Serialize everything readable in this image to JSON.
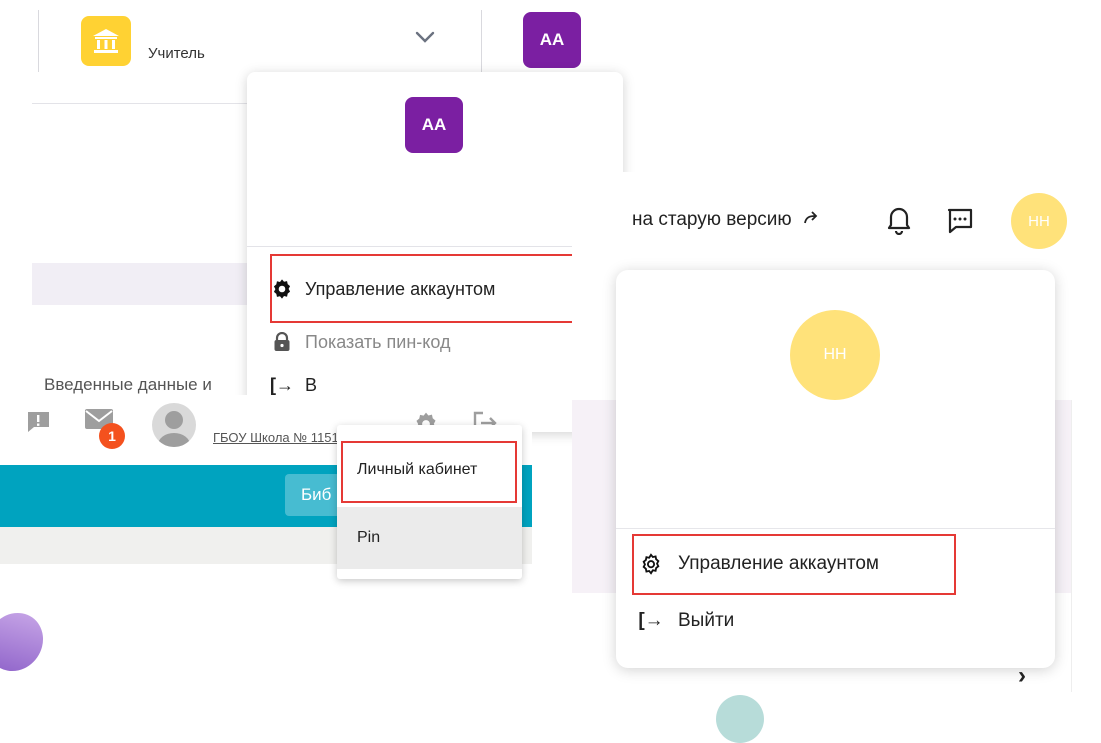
{
  "panel_a": {
    "role_label": "Учитель",
    "avatar_initials": "АА",
    "menu_avatar_initials": "АА",
    "truncated_text": "Введенные данные и",
    "menu": {
      "manage_account": "Управление аккаунтом",
      "show_pin": "Показать пин-код",
      "logout": "В"
    }
  },
  "panel_b": {
    "mail_badge": "1",
    "school_name": "ГБОУ Школа № 1151",
    "library_button": "Биб",
    "dropdown": {
      "personal_cabinet": "Личный кабинет",
      "pin": "Pin"
    }
  },
  "panel_c": {
    "old_version_link": "на старую версию",
    "avatar_initials": "НН",
    "menu_avatar_initials": "НН",
    "menu": {
      "manage_account": "Управление аккаунтом",
      "logout": "Выйти"
    }
  },
  "colors": {
    "highlight": "#e53935",
    "purple_avatar": "#7b1fa2",
    "yellow_icon": "#ffd233",
    "teal_bar": "#00a3bf",
    "badge": "#f4511e",
    "yellow_avatar": "#ffe27a"
  }
}
